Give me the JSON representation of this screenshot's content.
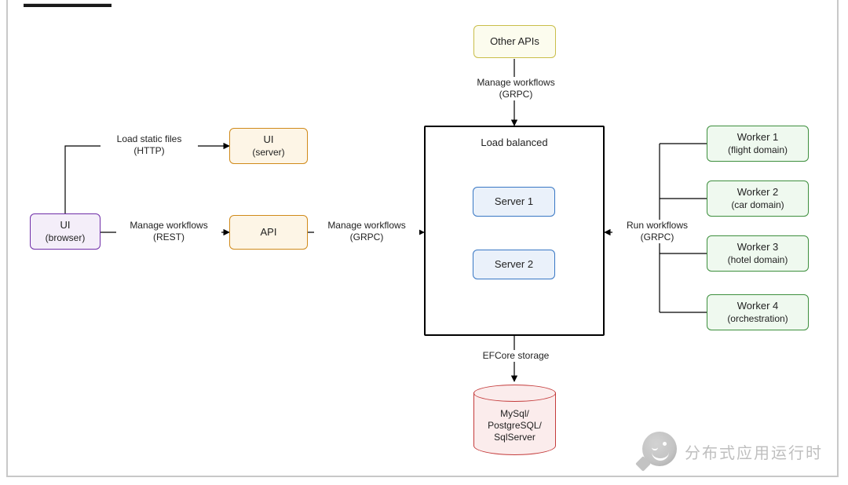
{
  "header": {
    "scribble": "▬▬▬▬▬▬▬▬"
  },
  "nodes": {
    "browser": {
      "title": "UI",
      "sub": "(browser)"
    },
    "ui_server": {
      "title": "UI",
      "sub": "(server)"
    },
    "api": {
      "title": "API"
    },
    "other_apis": {
      "title": "Other APIs"
    },
    "load_balanced": {
      "title": "Load balanced"
    },
    "server1": {
      "title": "Server 1"
    },
    "server2": {
      "title": "Server 2"
    },
    "worker1": {
      "title": "Worker 1",
      "sub": "(flight domain)"
    },
    "worker2": {
      "title": "Worker 2",
      "sub": "(car domain)"
    },
    "worker3": {
      "title": "Worker 3",
      "sub": "(hotel domain)"
    },
    "worker4": {
      "title": "Worker 4",
      "sub": "(orchestration)"
    },
    "db": {
      "line1": "MySql/",
      "line2": "PostgreSQL/",
      "line3": "SqlServer"
    }
  },
  "edges": {
    "browser_ui": {
      "l1": "Load static files",
      "l2": "(HTTP)"
    },
    "browser_api": {
      "l1": "Manage workflows",
      "l2": "(REST)"
    },
    "api_lb": {
      "l1": "Manage workflows",
      "l2": "(GRPC)"
    },
    "other_lb": {
      "l1": "Manage workflows",
      "l2": "(GRPC)"
    },
    "workers_lb": {
      "l1": "Run workflows",
      "l2": "(GRPC)"
    },
    "lb_db": {
      "l1": "EFCore storage"
    }
  },
  "watermark": {
    "text": "分布式应用运行时"
  }
}
